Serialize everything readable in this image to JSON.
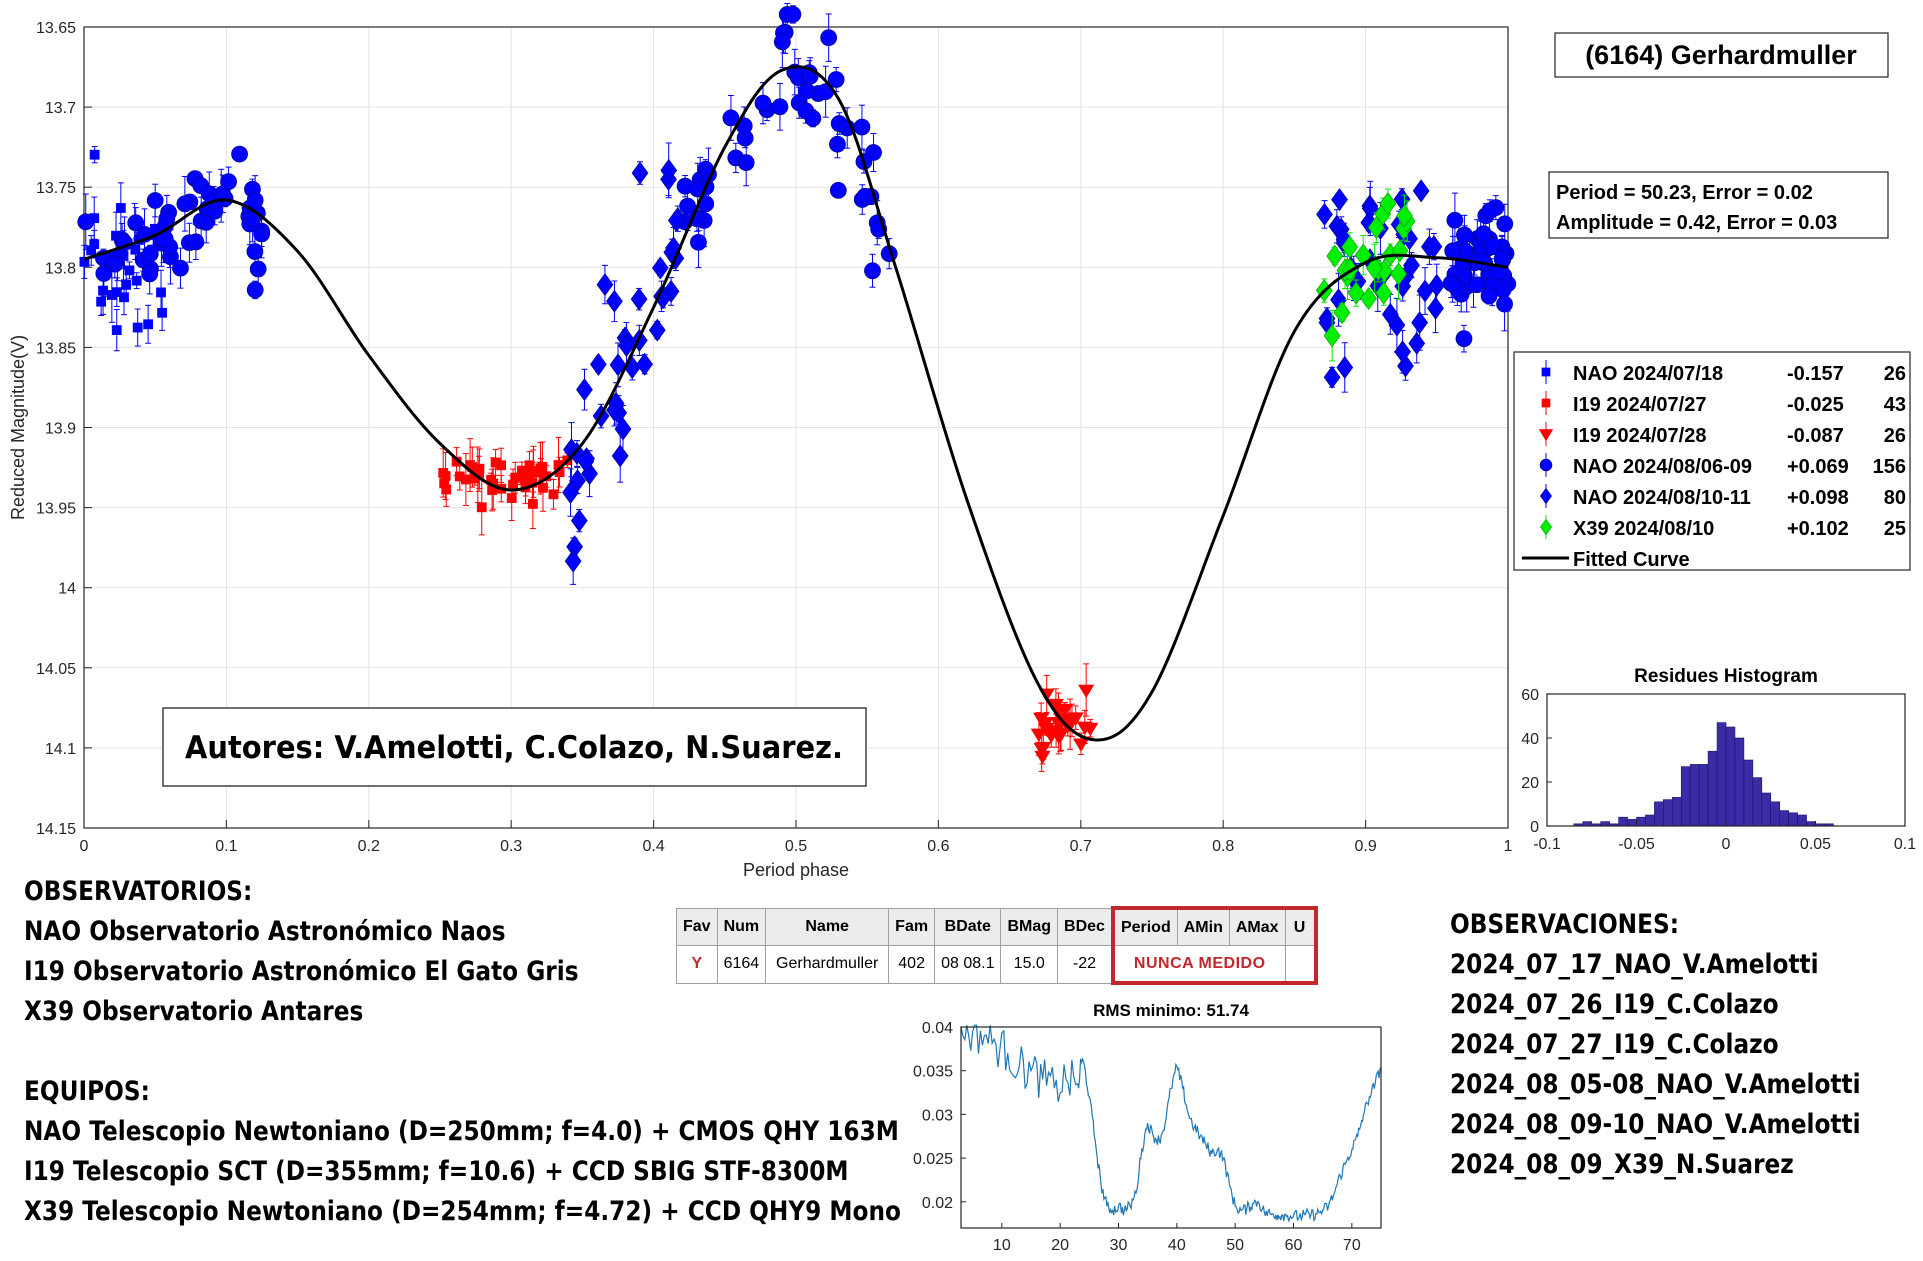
{
  "chart_data": [
    {
      "type": "scatter",
      "title": "(6164) Gerhardmuller",
      "xlabel": "Period phase",
      "ylabel": "Reduced Magnitude(V)",
      "xlim": [
        0,
        1
      ],
      "ylim": [
        13.65,
        14.15
      ],
      "y_reversed": true,
      "xticks": [
        "0",
        "0.1",
        "0.2",
        "0.3",
        "0.4",
        "0.5",
        "0.6",
        "0.7",
        "0.8",
        "0.9",
        "1"
      ],
      "yticks": [
        "13.65",
        "13.7",
        "13.75",
        "13.8",
        "13.85",
        "13.9",
        "13.95",
        "14",
        "14.05",
        "14.1",
        "14.15"
      ],
      "grid": true,
      "legend_position": "right",
      "period_text": "Period =  50.23, Error = 0.02",
      "amplitude_text": "Amplitude = 0.42, Error = 0.03",
      "series": [
        {
          "name": "NAO 2024/07/18",
          "offset": "-0.157",
          "count": "26",
          "marker": "square",
          "color": "#0000ff",
          "x_range": [
            0.0,
            0.055
          ],
          "y_center": 13.81,
          "y_spread": 0.04
        },
        {
          "name": "I19 2024/07/27",
          "offset": "-0.025",
          "count": "43",
          "marker": "square",
          "color": "#ff0000",
          "x_range": [
            0.25,
            0.34
          ],
          "y_center": 13.93,
          "y_spread": 0.015
        },
        {
          "name": "I19 2024/07/28",
          "offset": "-0.087",
          "count": "26",
          "marker": "triangle-down",
          "color": "#ff0000",
          "x_range": [
            0.67,
            0.71
          ],
          "y_center": 14.085,
          "y_spread": 0.02
        },
        {
          "name": "NAO 2024/08/06-09",
          "offset": "+0.069",
          "count": "156",
          "marker": "circle",
          "color": "#0000ff",
          "x_ranges": [
            [
              0.0,
              0.13
            ],
            [
              0.42,
              0.57
            ],
            [
              0.96,
              1.0
            ]
          ],
          "y_spread": 0.015
        },
        {
          "name": "NAO 2024/08/10-11",
          "offset": "+0.098",
          "count": "80",
          "marker": "diamond",
          "color": "#0000ff",
          "x_ranges": [
            [
              0.34,
              0.42
            ],
            [
              0.87,
              0.95
            ]
          ],
          "y_spread": 0.03
        },
        {
          "name": "X39 2024/08/10",
          "offset": "+0.102",
          "count": "25",
          "marker": "diamond",
          "color": "#00ee00",
          "x_range": [
            0.87,
            0.93
          ],
          "y_center": 13.79,
          "y_spread": 0.03
        }
      ],
      "fitted_curve": {
        "name": "Fitted Curve",
        "points": [
          [
            0.0,
            13.795
          ],
          [
            0.05,
            13.78
          ],
          [
            0.1,
            13.758
          ],
          [
            0.15,
            13.79
          ],
          [
            0.2,
            13.855
          ],
          [
            0.25,
            13.91
          ],
          [
            0.3,
            13.939
          ],
          [
            0.35,
            13.91
          ],
          [
            0.4,
            13.825
          ],
          [
            0.45,
            13.725
          ],
          [
            0.49,
            13.677
          ],
          [
            0.53,
            13.695
          ],
          [
            0.57,
            13.8
          ],
          [
            0.62,
            13.945
          ],
          [
            0.67,
            14.06
          ],
          [
            0.71,
            14.095
          ],
          [
            0.75,
            14.065
          ],
          [
            0.8,
            13.955
          ],
          [
            0.85,
            13.84
          ],
          [
            0.9,
            13.797
          ],
          [
            0.95,
            13.794
          ],
          [
            1.0,
            13.8
          ]
        ]
      }
    },
    {
      "type": "bar",
      "title": "Residues Histogram",
      "xlim": [
        -0.1,
        0.1
      ],
      "ylim": [
        0,
        60
      ],
      "xticks": [
        "-0.1",
        "-0.05",
        "0",
        "0.05",
        "0.1"
      ],
      "yticks": [
        "0",
        "20",
        "40",
        "60"
      ],
      "bin_width": 0.005,
      "bin_centers": [
        -0.0825,
        -0.0775,
        -0.0725,
        -0.0675,
        -0.0625,
        -0.0575,
        -0.0525,
        -0.0475,
        -0.0425,
        -0.0375,
        -0.0325,
        -0.0275,
        -0.0225,
        -0.0175,
        -0.0125,
        -0.0075,
        -0.0025,
        0.0025,
        0.0075,
        0.0125,
        0.0175,
        0.0225,
        0.0275,
        0.0325,
        0.0375,
        0.0425,
        0.0475,
        0.0525,
        0.0575,
        0.0625
      ],
      "values": [
        1,
        2,
        1,
        2,
        1,
        4,
        3,
        4,
        5,
        11,
        12,
        13,
        27,
        28,
        28,
        34,
        47,
        45,
        40,
        30,
        22,
        15,
        11,
        7,
        6,
        5,
        2,
        1,
        1,
        0
      ],
      "color": "#3a2ba6"
    },
    {
      "type": "line",
      "title": "RMS minimo: 51.74",
      "xlim": [
        3,
        75
      ],
      "ylim": [
        0.017,
        0.04
      ],
      "xticks": [
        "10",
        "20",
        "30",
        "40",
        "50",
        "60",
        "70"
      ],
      "yticks": [
        "0.02",
        "0.025",
        "0.03",
        "0.035",
        "0.04"
      ],
      "color": "#1f77b4",
      "x": [
        3,
        5,
        7,
        9,
        11,
        13,
        15,
        17,
        19,
        21,
        23,
        24,
        25,
        26,
        27,
        28,
        29,
        30,
        31,
        32,
        33,
        34,
        35,
        36,
        37,
        38,
        39,
        40,
        41,
        42,
        43,
        44,
        45,
        46,
        47,
        48,
        49,
        50,
        51,
        52,
        53,
        54,
        55,
        56,
        57,
        58,
        59,
        60,
        61,
        62,
        63,
        64,
        65,
        66,
        67,
        68,
        69,
        70,
        71,
        72,
        73,
        74,
        75
      ],
      "y": [
        0.04,
        0.0395,
        0.039,
        0.038,
        0.037,
        0.0355,
        0.035,
        0.034,
        0.033,
        0.034,
        0.0335,
        0.036,
        0.032,
        0.027,
        0.022,
        0.0195,
        0.019,
        0.0195,
        0.019,
        0.0195,
        0.021,
        0.026,
        0.029,
        0.0275,
        0.027,
        0.029,
        0.033,
        0.0355,
        0.033,
        0.03,
        0.0285,
        0.0275,
        0.0265,
        0.0255,
        0.026,
        0.025,
        0.022,
        0.0195,
        0.019,
        0.0192,
        0.0198,
        0.02,
        0.0188,
        0.0186,
        0.0185,
        0.0185,
        0.0184,
        0.0184,
        0.0183,
        0.0185,
        0.0185,
        0.0186,
        0.019,
        0.0195,
        0.021,
        0.023,
        0.0245,
        0.026,
        0.0275,
        0.03,
        0.032,
        0.0335,
        0.0355
      ]
    }
  ],
  "authors": "Autores: V.Amelotti, C.Colazo, N.Suarez.",
  "observatorios": {
    "title": "OBSERVATORIOS:",
    "lines": [
      "NAO Observatorio Astronómico Naos",
      "I19 Observatorio Astronómico El Gato Gris",
      "X39 Observatorio Antares"
    ]
  },
  "equipos": {
    "title": "EQUIPOS:",
    "lines": [
      "NAO Telescopio Newtoniano (D=250mm; f=4.0) + CMOS QHY 163M",
      "I19 Telescopio SCT (D=355mm; f=10.6) + CCD SBIG STF-8300M",
      "X39 Telescopio Newtoniano (D=254mm; f=4.72) + CCD QHY9 Mono"
    ]
  },
  "observaciones": {
    "title": "OBSERVACIONES:",
    "lines": [
      "2024_07_17_NAO_V.Amelotti",
      "2024_07_26_I19_C.Colazo",
      "2024_07_27_I19_C.Colazo",
      "2024_08_05-08_NAO_V.Amelotti",
      "2024_08_09-10_NAO_V.Amelotti",
      "2024_08_09_X39_N.Suarez"
    ]
  },
  "table": {
    "headers": [
      "Fav",
      "Num",
      "Name",
      "Fam",
      "BDate",
      "BMag",
      "BDec",
      "Period",
      "AMin",
      "AMax",
      "U"
    ],
    "row": [
      "Y",
      "6164",
      "Gerhardmuller",
      "402",
      "08 08.1",
      "15.0",
      "-22"
    ],
    "nunca": "NUNCA MEDIDO",
    "highlight_color": "#c0282d"
  }
}
